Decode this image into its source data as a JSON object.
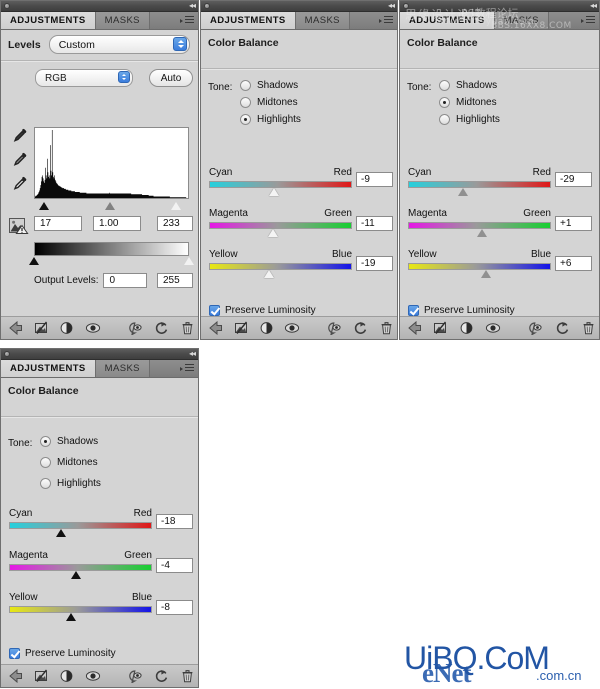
{
  "window": {
    "tabs": [
      "ADJUSTMENTS",
      "MASKS"
    ],
    "active_tab": "ADJUSTMENTS",
    "menu_icon": "panel-menu-icon",
    "collapse_icon": "collapse-chevrons-icon"
  },
  "levels_panel": {
    "preset_label": "Levels",
    "preset_value": "Custom",
    "channel_value": "RGB",
    "auto_label": "Auto",
    "eyedroppers": [
      "black-point-eyedropper",
      "gray-point-eyedropper",
      "white-point-eyedropper"
    ],
    "warning_icon": "histogram-warning-icon",
    "input_shadow": "17",
    "input_gamma": "1.00",
    "input_highlight": "233",
    "output_label": "Output Levels:",
    "output_shadow": "0",
    "output_highlight": "255",
    "handle_positions": {
      "shadow_pct": 6.7,
      "gamma_pct": 49.0,
      "highlight_pct": 91.4
    },
    "output_handle_positions": {
      "shadow_pct": 0,
      "highlight_pct": 100
    },
    "histogram": [
      2,
      3,
      3,
      4,
      5,
      6,
      8,
      10,
      13,
      17,
      22,
      28,
      30,
      26,
      22,
      20,
      24,
      40,
      30,
      26,
      52,
      34,
      28,
      30,
      26,
      70,
      36,
      30,
      90,
      34,
      28,
      26,
      30,
      24,
      22,
      20,
      19,
      18,
      17,
      16,
      16,
      15,
      15,
      14,
      14,
      13,
      13,
      13,
      12,
      12,
      12,
      11,
      11,
      11,
      11,
      10,
      10,
      10,
      10,
      10,
      9,
      9,
      9,
      9,
      9,
      9,
      8,
      8,
      8,
      8,
      8,
      8,
      8,
      8,
      7,
      7,
      7,
      7,
      7,
      7,
      7,
      7,
      7,
      7,
      7,
      6,
      6,
      6,
      6,
      6,
      6,
      6,
      6,
      6,
      6,
      6,
      6,
      6,
      6,
      6,
      6,
      6,
      6,
      6,
      6,
      6,
      6,
      6,
      6,
      6,
      6,
      6,
      6,
      6,
      6,
      6,
      6,
      6,
      6,
      6,
      6,
      6,
      6,
      7,
      6,
      6,
      6,
      6,
      6,
      6,
      6,
      6,
      6,
      6,
      6,
      6,
      6,
      6,
      6,
      6,
      6,
      6,
      6,
      6,
      6,
      6,
      6,
      6,
      6,
      6,
      6,
      6,
      6,
      6,
      6,
      6,
      6,
      6,
      6,
      5,
      5,
      5,
      5,
      5,
      5,
      5,
      5,
      5,
      5,
      5,
      5,
      5,
      5,
      5,
      5,
      5,
      5,
      4,
      4,
      4,
      4,
      4,
      4,
      4,
      4,
      4,
      4,
      4,
      3,
      3,
      3,
      3,
      3,
      3,
      3,
      3,
      2,
      2,
      2,
      2,
      2,
      2,
      2,
      2,
      2,
      2,
      2,
      2,
      2,
      2,
      2,
      2,
      2,
      2,
      2,
      2,
      2,
      2,
      2,
      2,
      2,
      2,
      2,
      1,
      1,
      1,
      1,
      1,
      1,
      1,
      1,
      1,
      1,
      1,
      1,
      1,
      1,
      1,
      1,
      1,
      1,
      1,
      1,
      1,
      1,
      1,
      1,
      1,
      1,
      1,
      0,
      0,
      0
    ]
  },
  "color_balance": {
    "title": "Color Balance",
    "tone_label": "Tone:",
    "tone_options": [
      "Shadows",
      "Midtones",
      "Highlights"
    ],
    "slider_labels": [
      {
        "left": "Cyan",
        "right": "Red"
      },
      {
        "left": "Magenta",
        "right": "Green"
      },
      {
        "left": "Yellow",
        "right": "Blue"
      }
    ],
    "preserve_label": "Preserve Luminosity"
  },
  "panel_highlights": {
    "selected_tone": "Highlights",
    "cyan_red": "-9",
    "magenta_green": "-11",
    "yellow_blue": "-19",
    "knob_pct": [
      45.0,
      44.0,
      41.0
    ],
    "knob_style": "white",
    "preserve_luminosity": true
  },
  "panel_midtones": {
    "selected_tone": "Midtones",
    "cyan_red": "-29",
    "magenta_green": "+1",
    "yellow_blue": "+6",
    "knob_pct": [
      38.0,
      51.0,
      54.0
    ],
    "knob_style": "gray",
    "preserve_luminosity": true
  },
  "panel_shadows": {
    "selected_tone": "Shadows",
    "cyan_red": "-18",
    "magenta_green": "-4",
    "yellow_blue": "-8",
    "knob_pct": [
      36.0,
      46.0,
      43.0
    ],
    "knob_style": "black",
    "preserve_luminosity": true
  },
  "toolbar": {
    "icons": [
      "return-to-previous-state-icon",
      "clip-to-layer-icon",
      "view-previous-state-icon",
      "toggle-visibility-eye-icon",
      "mask-preview-icon",
      "reset-adjustment-icon",
      "delete-adjustment-icon"
    ]
  },
  "watermarks": {
    "top_line1": "思缘设计论坛",
    "top_line2": "www.missyuan.com",
    "top_line3": "PS教程论坛",
    "top_line4": "BBS.16XX8.COM",
    "bottom_primary": "UiBQ.CoM",
    "bottom_secondary": "eNet",
    "bottom_secondary_suffix": ".com.cn"
  }
}
